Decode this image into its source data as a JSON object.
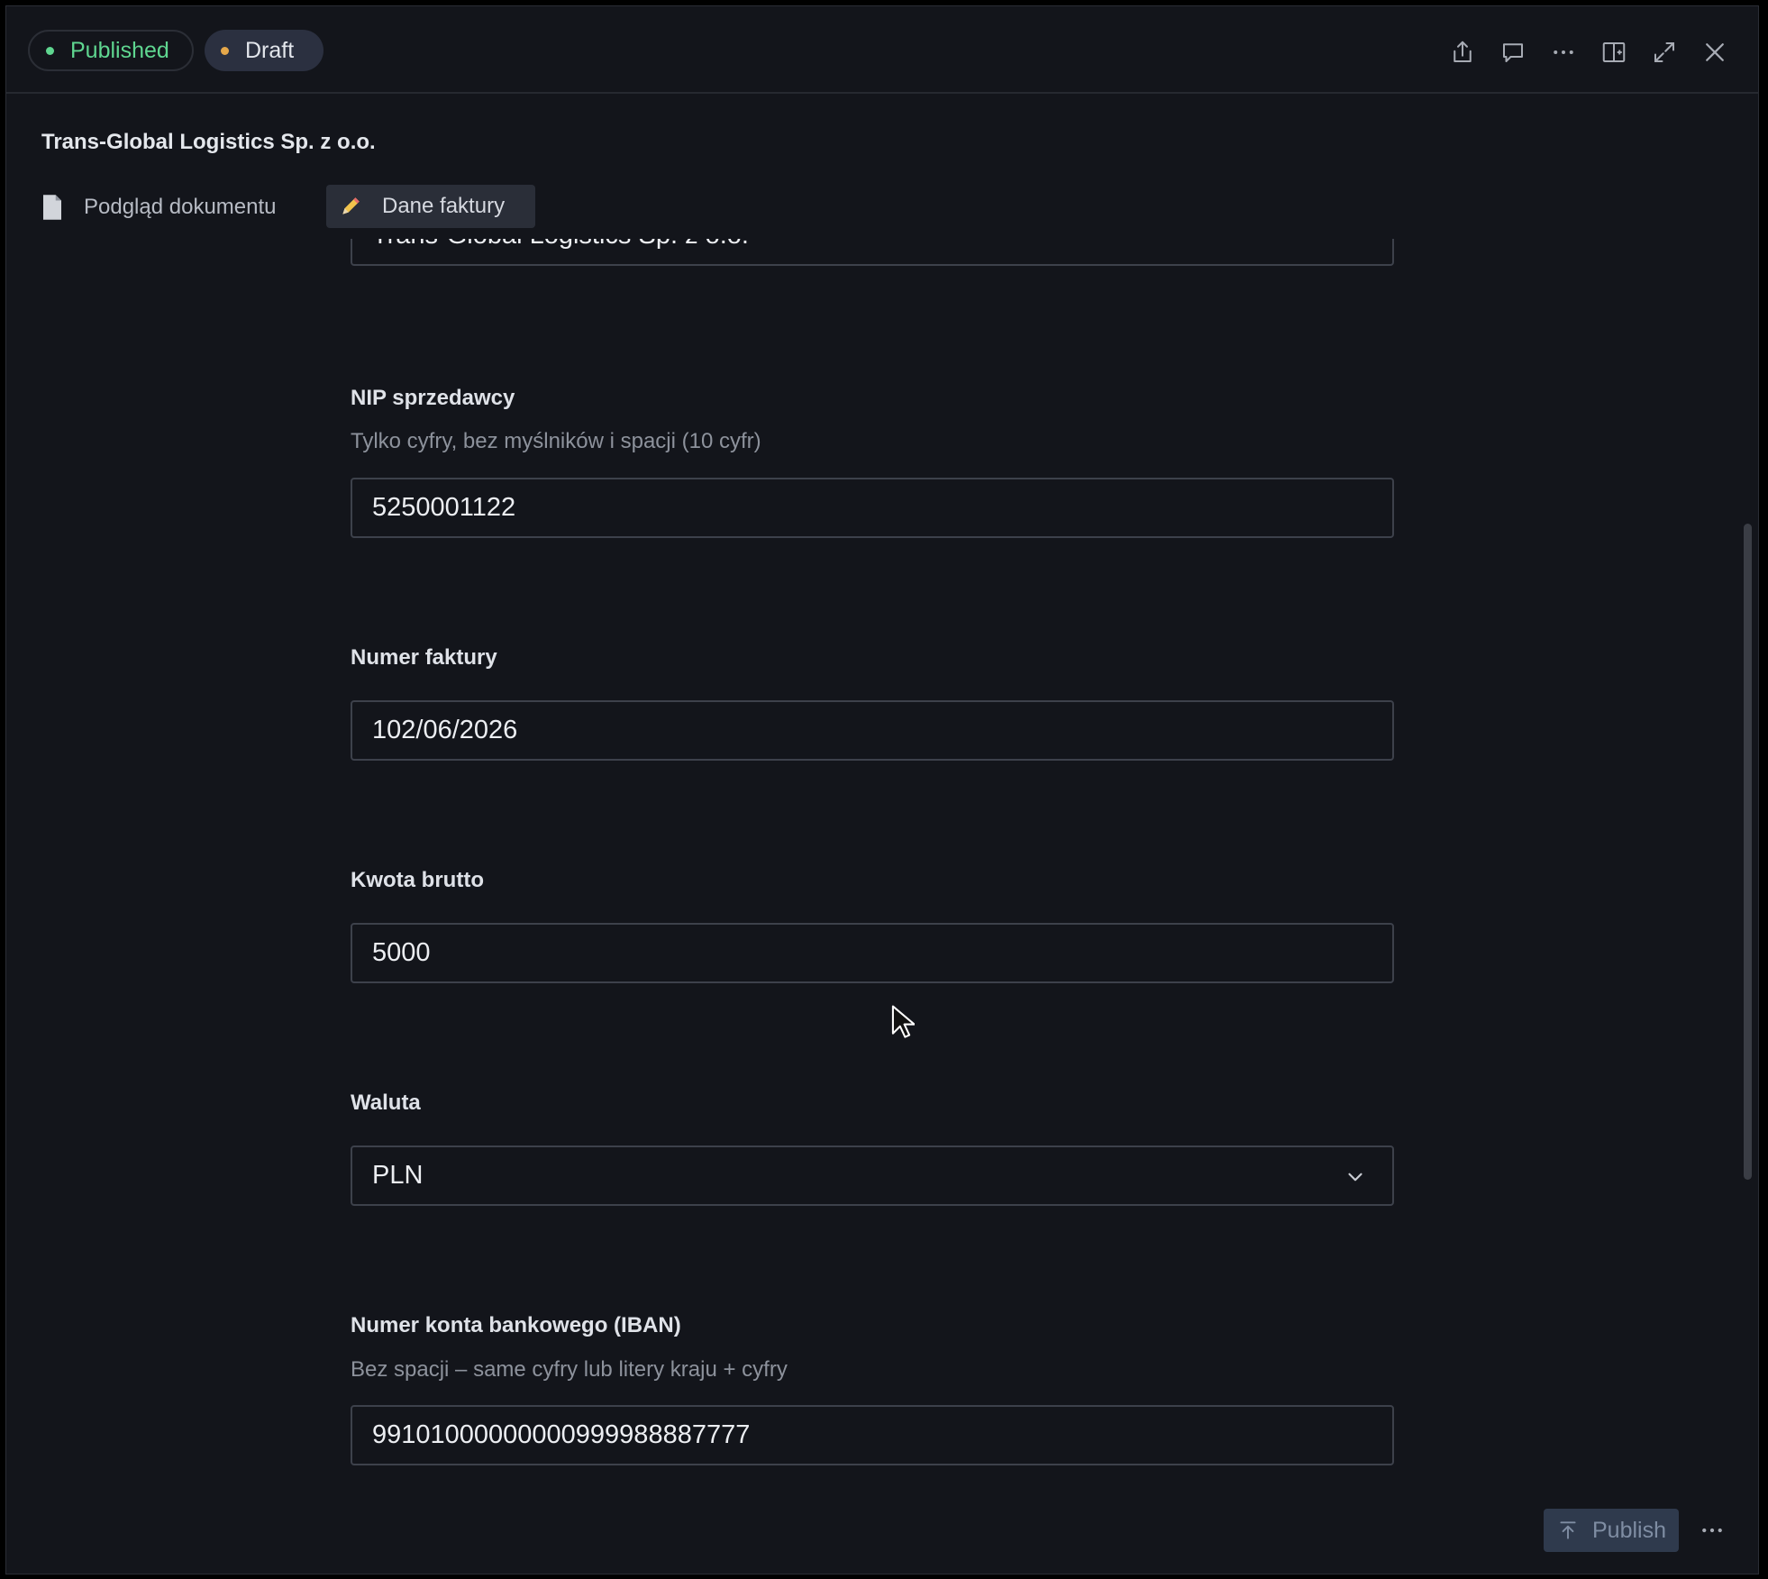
{
  "status": {
    "published_label": "Published",
    "draft_label": "Draft",
    "published_color": "#5fd690",
    "draft_color": "#e6a84a"
  },
  "toolbar": {
    "icons": [
      "share-icon",
      "comment-icon",
      "more-horizontal-icon",
      "split-view-icon",
      "expand-icon",
      "close-icon"
    ]
  },
  "document": {
    "title": "Trans-Global Logistics Sp. z o.o."
  },
  "tabs": [
    {
      "label": "Podgląd dokumentu",
      "icon": "document-icon"
    },
    {
      "label": "Dane faktury",
      "icon": "pencil-icon",
      "active": true
    }
  ],
  "form": {
    "seller_name_value": "Trans-Global Logistics Sp. z o.o.",
    "nip": {
      "label": "NIP sprzedawcy",
      "hint": "Tylko cyfry, bez myślników i spacji (10 cyfr)",
      "value": "5250001122"
    },
    "invoice_number": {
      "label": "Numer faktury",
      "value": "102/06/2026"
    },
    "gross_amount": {
      "label": "Kwota brutto",
      "value": "5000"
    },
    "currency": {
      "label": "Waluta",
      "value": "PLN"
    },
    "iban": {
      "label": "Numer konta bankowego (IBAN)",
      "hint": "Bez spacji – same cyfry lub litery kraju + cyfry",
      "value": "99101000000000999988887777"
    }
  },
  "footer": {
    "publish_label": "Publish"
  }
}
